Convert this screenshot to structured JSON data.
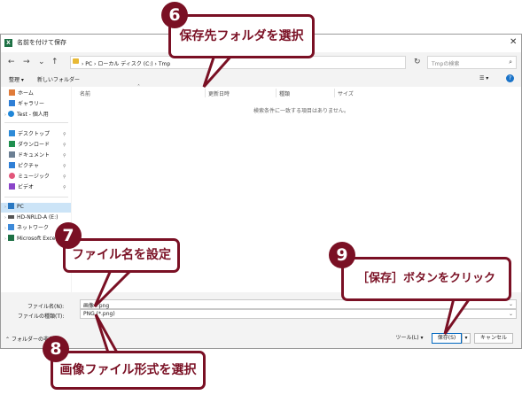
{
  "window": {
    "title": "名前を付けて保存",
    "app_icon": "excel-icon",
    "close_glyph": "✕"
  },
  "nav": {
    "back": "←",
    "forward": "→",
    "up_list": "⌄",
    "up": "↑",
    "address": "›  PC  ›  ローカル ディスク (C:)  ›  Tmp",
    "refresh": "↻",
    "search_placeholder": "Tmpの検索"
  },
  "command_bar": {
    "organize": "整理 ▾",
    "new_folder": "新しいフォルダー",
    "view": "☰ ▾",
    "help": "?"
  },
  "sidebar": {
    "items": [
      {
        "label": "ホーム",
        "icon": "home-icon",
        "pinned": false
      },
      {
        "label": "ギャラリー",
        "icon": "gallery-icon",
        "pinned": false
      },
      {
        "label": "Test - 個人用",
        "icon": "cloud-icon",
        "pinned": false
      },
      {
        "label": "デスクトップ",
        "icon": "desktop-icon",
        "pinned": true
      },
      {
        "label": "ダウンロード",
        "icon": "download-icon",
        "pinned": true
      },
      {
        "label": "ドキュメント",
        "icon": "document-icon",
        "pinned": true
      },
      {
        "label": "ピクチャ",
        "icon": "pictures-icon",
        "pinned": true
      },
      {
        "label": "ミュージック",
        "icon": "music-icon",
        "pinned": true
      },
      {
        "label": "ビデオ",
        "icon": "video-icon",
        "pinned": true
      },
      {
        "label": "PC",
        "icon": "pc-icon",
        "selected": true
      },
      {
        "label": "HD-NRLD-A (E:)",
        "icon": "drive-icon"
      },
      {
        "label": "ネットワーク",
        "icon": "network-icon"
      },
      {
        "label": "Microsoft Exce",
        "icon": "excel-icon"
      }
    ],
    "pin_glyph": "📌"
  },
  "content": {
    "columns": [
      "名前",
      "更新日時",
      "種類",
      "サイズ"
    ],
    "empty_message": "検索条件に一致する項目はありません。"
  },
  "form": {
    "filename_label": "ファイル名(N):",
    "filename_value": "画像4.png",
    "filetype_label": "ファイルの種類(T):",
    "filetype_value": "PNG (*.png)"
  },
  "footer": {
    "hide_folders": "フォルダーの非表示",
    "tools": "ツール(L) ▾",
    "save": "保存(S)",
    "save_dropdown": "▾",
    "cancel": "キャンセル"
  },
  "annotations": [
    {
      "number": "6",
      "text": "保存先フォルダを選択"
    },
    {
      "number": "7",
      "text": "ファイル名を設定"
    },
    {
      "number": "8",
      "text": "画像ファイル形式を選択"
    },
    {
      "number": "9",
      "text": "［保存］ボタンをクリック"
    }
  ],
  "colors": {
    "accent": "#7a1024",
    "selection": "#cce4f7",
    "primary_border": "#0067c0"
  }
}
